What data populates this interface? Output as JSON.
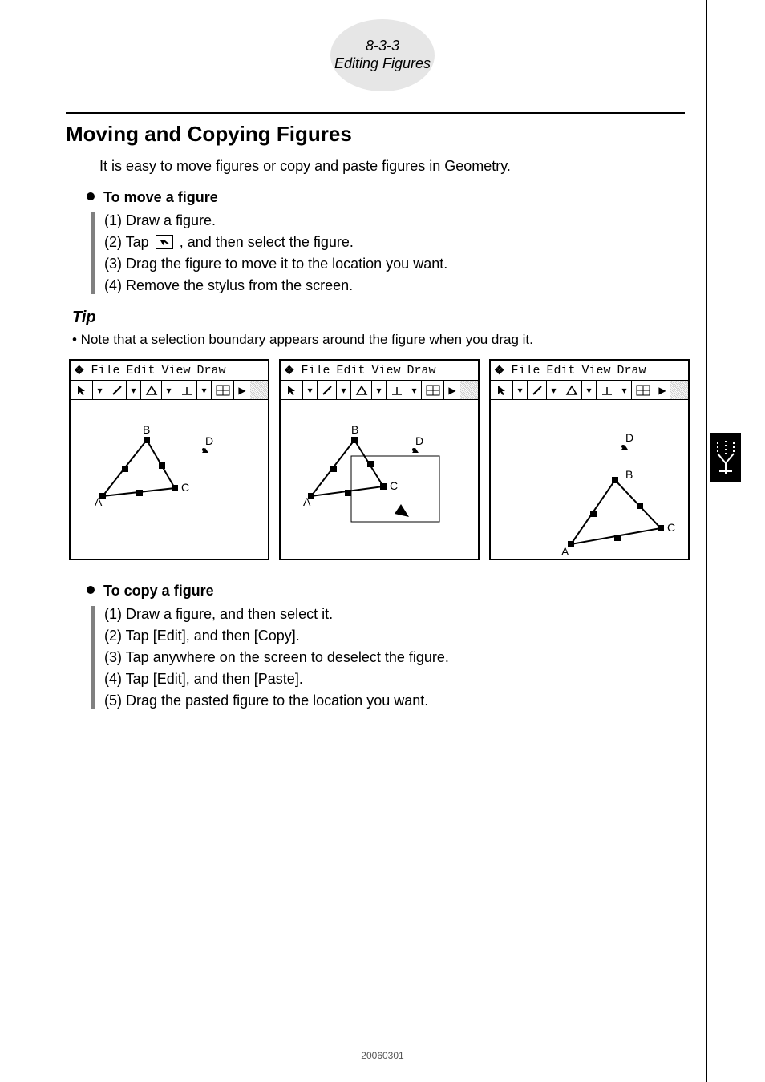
{
  "header": {
    "page_ref": "8-3-3",
    "page_title": "Editing Figures"
  },
  "section_title": "Moving and Copying Figures",
  "intro": "It is easy to move figures or copy and paste figures in Geometry.",
  "move": {
    "heading": "To move a figure",
    "steps": [
      "(1) Draw a figure.",
      "(2) Tap ",
      ", and then select the figure.",
      "(3) Drag the figure to move it to the location you want.",
      "(4) Remove the stylus from the screen."
    ]
  },
  "tip": {
    "heading": "Tip",
    "body": "• Note that a selection boundary appears around the figure when you drag it."
  },
  "calc_menu": {
    "items": [
      "File",
      "Edit",
      "View",
      "Draw"
    ]
  },
  "screenshots": {
    "pt_labels": {
      "A": "A",
      "B": "B",
      "C": "C",
      "D": "D"
    }
  },
  "copy": {
    "heading": "To copy a figure",
    "steps": [
      "(1) Draw a figure, and then select it.",
      "(2) Tap [Edit], and then [Copy].",
      "(3) Tap anywhere on the screen to deselect the figure.",
      "(4) Tap [Edit], and then [Paste].",
      "(5) Drag the pasted figure to the location you want."
    ]
  },
  "footer_num": "20060301"
}
